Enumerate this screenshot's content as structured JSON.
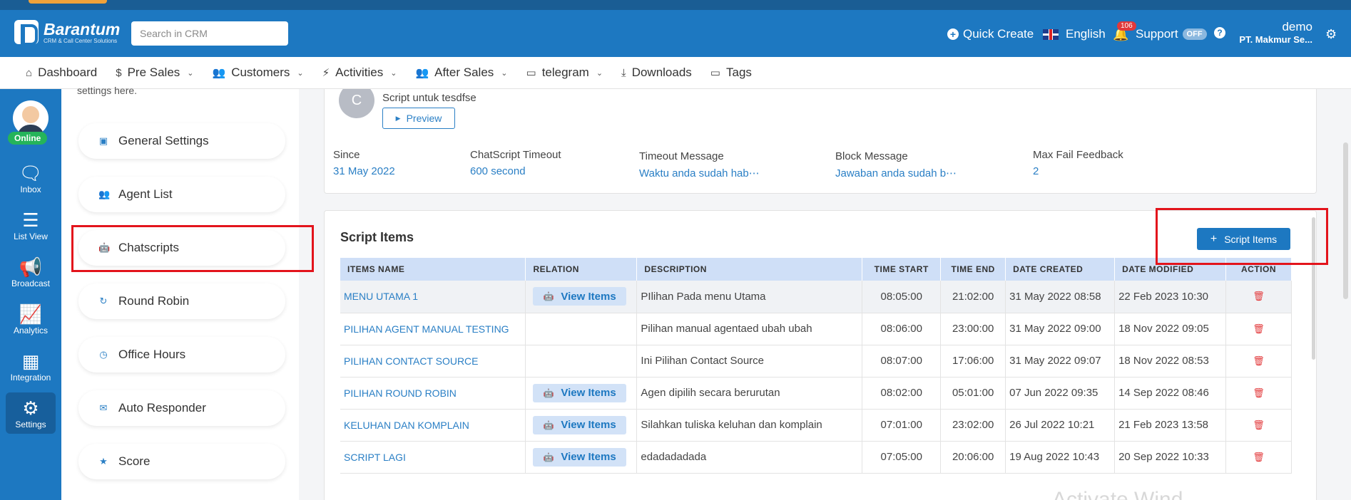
{
  "header": {
    "logo_name": "Barantum",
    "logo_sub": "CRM & Call Center Solutions",
    "search_placeholder": "Search in CRM",
    "quick_create": "Quick Create",
    "language": "English",
    "notif_count": "106",
    "support": "Support",
    "support_toggle": "OFF",
    "user_name": "demo",
    "user_company": "PT. Makmur Se..."
  },
  "nav": [
    {
      "label": "Dashboard",
      "icon": "home-icon",
      "glyph": "⌂",
      "caret": ""
    },
    {
      "label": "Pre Sales",
      "icon": "dollar-icon",
      "glyph": "$",
      "caret": "⌄"
    },
    {
      "label": "Customers",
      "icon": "users-icon",
      "glyph": "👥",
      "caret": "⌄"
    },
    {
      "label": "Activities",
      "icon": "activity-icon",
      "glyph": "⚡",
      "caret": "⌄"
    },
    {
      "label": "After Sales",
      "icon": "handshake-icon",
      "glyph": "👥",
      "caret": "⌄"
    },
    {
      "label": "telegram",
      "icon": "folder-icon",
      "glyph": "▭",
      "caret": "⌄"
    },
    {
      "label": "Downloads",
      "icon": "download-icon",
      "glyph": "⤓",
      "caret": ""
    },
    {
      "label": "Tags",
      "icon": "folder-icon",
      "glyph": "▭",
      "caret": ""
    }
  ],
  "rail": {
    "status": "Online",
    "items": [
      {
        "label": "Inbox",
        "icon": "inbox-icon",
        "glyph": "🗨"
      },
      {
        "label": "List View",
        "icon": "list-view-icon",
        "glyph": "☰"
      },
      {
        "label": "Broadcast",
        "icon": "megaphone-icon",
        "glyph": "📢"
      },
      {
        "label": "Analytics",
        "icon": "chart-icon",
        "glyph": "📈"
      },
      {
        "label": "Integration",
        "icon": "grid-icon",
        "glyph": "▦"
      },
      {
        "label": "Settings",
        "icon": "gear-icon",
        "glyph": "⚙"
      }
    ]
  },
  "settings_menu": {
    "top_text": "settings here.",
    "items": [
      {
        "label": "General Settings",
        "icon": "settings-window-icon",
        "glyph": "▣"
      },
      {
        "label": "Agent List",
        "icon": "agents-icon",
        "glyph": "👥"
      },
      {
        "label": "Chatscripts",
        "icon": "robot-icon",
        "glyph": "🤖"
      },
      {
        "label": "Round Robin",
        "icon": "refresh-icon",
        "glyph": "↻"
      },
      {
        "label": "Office Hours",
        "icon": "clock-icon",
        "glyph": "◷"
      },
      {
        "label": "Auto Responder",
        "icon": "auto-reply-icon",
        "glyph": "✉"
      },
      {
        "label": "Score",
        "icon": "star-icon",
        "glyph": "★"
      }
    ]
  },
  "script_card": {
    "avatar_letter": "C",
    "subtitle": "Script untuk tesdfse",
    "preview_label": "Preview",
    "meta": [
      {
        "label": "Since",
        "value": "31 May 2022"
      },
      {
        "label": "ChatScript Timeout",
        "value": "600 second"
      },
      {
        "label": "Timeout Message",
        "value": "Waktu anda sudah hab⋯"
      },
      {
        "label": "Block Message",
        "value": "Jawaban anda sudah b⋯"
      },
      {
        "label": "Max Fail Feedback",
        "value": "2"
      }
    ]
  },
  "script_items": {
    "title": "Script Items",
    "add_label": "Script Items",
    "view_label": "View Items",
    "columns": [
      "ITEMS NAME",
      "RELATION",
      "DESCRIPTION",
      "TIME START",
      "TIME END",
      "DATE CREATED",
      "DATE MODIFIED",
      "ACTION"
    ],
    "rows": [
      {
        "name": "MENU UTAMA 1",
        "relation": true,
        "description": "PIlihan Pada menu Utama",
        "time_start": "08:05:00",
        "time_end": "21:02:00",
        "created": "31 May 2022 08:58",
        "modified": "22 Feb 2023 10:30"
      },
      {
        "name": "PILIHAN AGENT MANUAL TESTING",
        "relation": false,
        "description": "Pilihan manual agentaed ubah ubah",
        "time_start": "08:06:00",
        "time_end": "23:00:00",
        "created": "31 May 2022 09:00",
        "modified": "18 Nov 2022 09:05"
      },
      {
        "name": "PILIHAN CONTACT SOURCE",
        "relation": false,
        "description": "Ini Pilihan Contact Source",
        "time_start": "08:07:00",
        "time_end": "17:06:00",
        "created": "31 May 2022 09:07",
        "modified": "18 Nov 2022 08:53"
      },
      {
        "name": "PILIHAN ROUND ROBIN",
        "relation": true,
        "description": "Agen dipilih secara berurutan",
        "time_start": "08:02:00",
        "time_end": "05:01:00",
        "created": "07 Jun 2022 09:35",
        "modified": "14 Sep 2022 08:46"
      },
      {
        "name": "KELUHAN DAN KOMPLAIN",
        "relation": true,
        "description": "Silahkan tuliska keluhan dan komplain",
        "time_start": "07:01:00",
        "time_end": "23:02:00",
        "created": "26 Jul 2022 10:21",
        "modified": "21 Feb 2023 13:58"
      },
      {
        "name": "SCRIPT LAGI",
        "relation": true,
        "description": "edadadadada",
        "time_start": "07:05:00",
        "time_end": "20:06:00",
        "created": "19 Aug 2022 10:43",
        "modified": "20 Sep 2022 10:33"
      }
    ]
  },
  "watermark": "Activate Wind",
  "colors": {
    "primary": "#1d78c1",
    "highlight": "#e3141c",
    "online": "#25b45a"
  }
}
